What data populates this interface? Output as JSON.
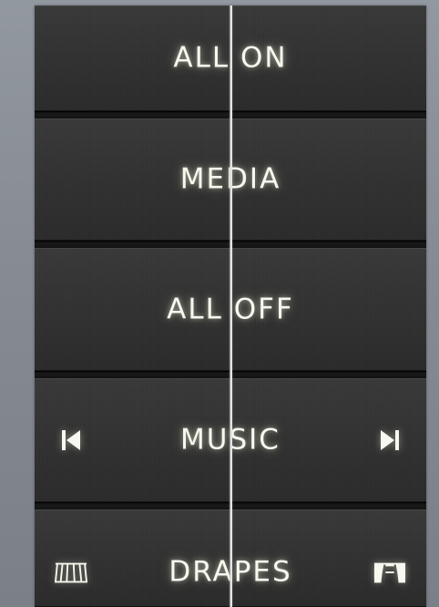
{
  "colors": {
    "label": "#f7f8ef",
    "button": "#323232",
    "separator": "#151515",
    "background": "#878c94",
    "divider": "#f3f3f3"
  },
  "buttons": {
    "all_on": {
      "label": "ALL ON"
    },
    "media": {
      "label": "MEDIA"
    },
    "all_off": {
      "label": "ALL OFF"
    },
    "music": {
      "label": "MUSIC",
      "left_icon": "skip-previous-icon",
      "right_icon": "skip-next-icon"
    },
    "drapes": {
      "label": "DRAPES",
      "left_icon": "drapes-closed-icon",
      "right_icon": "drapes-open-icon"
    }
  }
}
